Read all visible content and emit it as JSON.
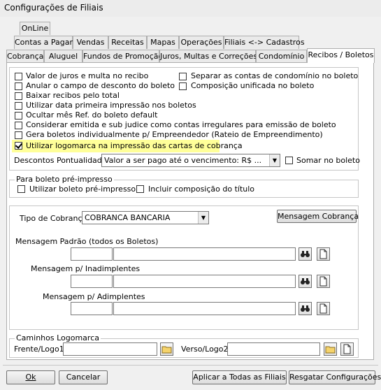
{
  "window": {
    "title": "Configurações de Filiais"
  },
  "tabs_row1": [
    "OnLine"
  ],
  "tabs_row2": [
    "Contas a Pagar",
    "Vendas",
    "Receitas",
    "Mapas",
    "Operações",
    "Filiais <-> Cadastros"
  ],
  "tabs_row3": [
    "Cobrança",
    "Aluguel",
    "Fundos de Promoção",
    "Juros, Multas e Correções",
    "Condomínio",
    "Recibos / Boletos"
  ],
  "options": {
    "left": [
      {
        "label": "Valor de juros e multa no recibo",
        "checked": false
      },
      {
        "label": "Anular o campo de desconto do boleto",
        "checked": false
      },
      {
        "label": "Baixar recibos pelo total",
        "checked": false
      },
      {
        "label": "Utilizar data primeira impressão nos boletos",
        "checked": false
      },
      {
        "label": "Ocultar mês Ref. do boleto default",
        "checked": false
      },
      {
        "label": "Considerar emitida e sub judice como contas irregulares para emissão de boleto",
        "checked": false
      },
      {
        "label": "Gera boletos individualmente p/ Empreendedor (Rateio de Empreendimento)",
        "checked": false
      },
      {
        "label": "Utilizar logomarca na impressão das cartas de cobrança",
        "checked": true
      }
    ],
    "right": [
      {
        "label": "Separar as contas de condomínio no boleto",
        "checked": false
      },
      {
        "label": "Composição unificada no boleto",
        "checked": false
      }
    ]
  },
  "descontos": {
    "label": "Descontos Pontualidade",
    "value": "Valor a ser pago até o vencimento: R$ ...",
    "somar_label": "Somar no boleto",
    "somar_checked": false
  },
  "preimpresso": {
    "title": "Para boleto pré-impresso",
    "utilizar_label": "Utilizar boleto pré-impresso",
    "incluir_label": "Incluir composição do título"
  },
  "cobranca": {
    "tipo_label": "Tipo de Cobrança",
    "tipo_value": "COBRANCA BANCARIA",
    "mensagem_button": "Mensagem Cobrança",
    "msg_padrao_label": "Mensagem Padrão (todos os Boletos)",
    "msg_inadimplentes_label": "Mensagem p/ Inadimplentes",
    "msg_adimplentes_label": "Mensagem p/ Adimplentes"
  },
  "logomarca": {
    "title": "Caminhos Logomarca",
    "frente_label": "Frente/Logo1:",
    "verso_label": "Verso/Logo2:"
  },
  "footer": {
    "ok": "Ok",
    "cancelar": "Cancelar",
    "aplicar": "Aplicar a Todas as Filiais",
    "resgatar": "Resgatar Configurações"
  }
}
